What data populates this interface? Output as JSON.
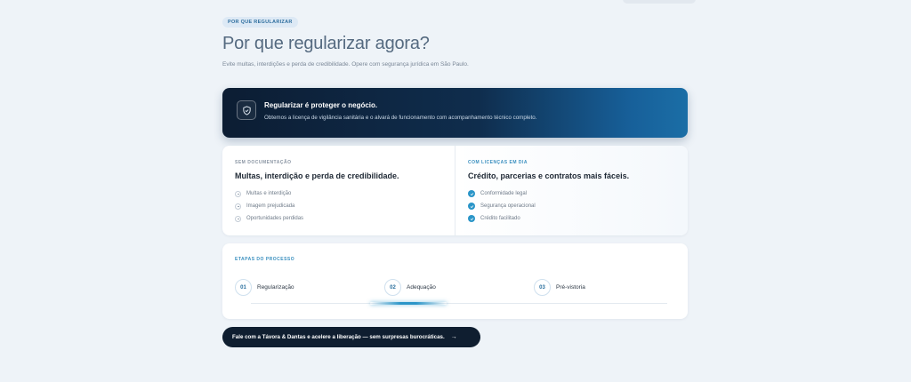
{
  "header": {
    "eyebrow": "POR QUE REGULARIZAR",
    "title": "Por que regularizar agora?",
    "subtitle": "Evite multas, interdições e perda de credibilidade. Opere com segurança jurídica em São Paulo."
  },
  "hero": {
    "icon": "shield-check-icon",
    "title": "Regularizar é proteger o negócio.",
    "text": "Obtemos a licença de vigilância sanitária e o alvará de funcionamento com acompanhamento técnico completo."
  },
  "comparison": {
    "left": {
      "eyebrow": "SEM DOCUMENTAÇÃO",
      "title": "Multas, interdição e perda de credibilidade.",
      "items": [
        "Multas e interdição",
        "Imagem prejudicada",
        "Oportunidades perdidas"
      ]
    },
    "right": {
      "eyebrow": "COM LICENÇAS EM DIA",
      "title": "Crédito, parcerias e contratos mais fáceis.",
      "items": [
        "Conformidade legal",
        "Segurança operacional",
        "Crédito facilitado"
      ]
    }
  },
  "process": {
    "eyebrow": "ETAPAS DO PROCESSO",
    "steps": [
      {
        "num": "01",
        "label": "Regularização"
      },
      {
        "num": "02",
        "label": "Adequação"
      },
      {
        "num": "03",
        "label": "Pré-vistoria"
      }
    ]
  },
  "cta": {
    "label": "Fale com a Távora & Dantas e acelere a liberação — sem surpresas burocráticas.",
    "arrow": "→"
  },
  "colors": {
    "accent": "#2a95c8",
    "hero_dark": "#0c1d33",
    "cta_bg": "#0f1e30"
  }
}
